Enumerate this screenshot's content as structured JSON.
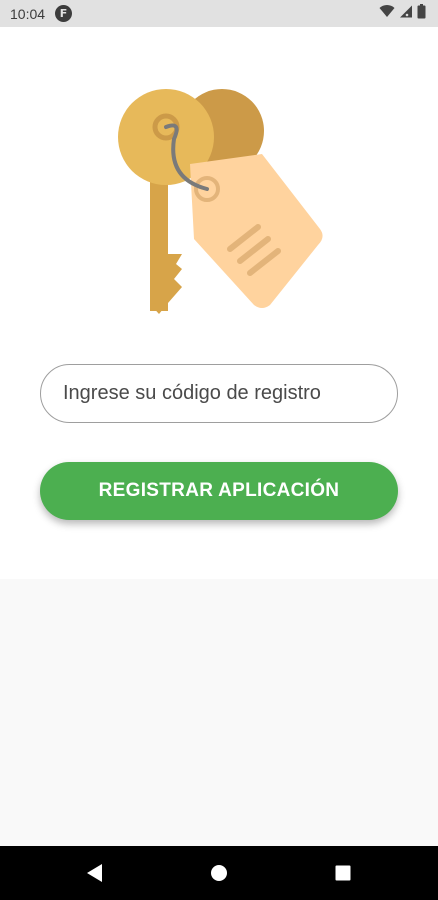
{
  "status_bar": {
    "time": "10:04",
    "notification_icon": "flipboard-icon",
    "notification_letter": "F",
    "icons": [
      "wifi-icon",
      "signal-icon",
      "battery-icon"
    ]
  },
  "illustration": {
    "icon": "keys-with-tag-icon",
    "colors": {
      "key_front": "#E7B95A",
      "key_back": "#CC9A48",
      "key_shaft": "#D7A449",
      "tag": "#FFD39E",
      "tag_lines": "#E3B47A",
      "cord": "#7A7A7A"
    }
  },
  "form": {
    "code_placeholder": "Ingrese su código de registro",
    "code_value": "",
    "register_label": "REGISTRAR APLICACIÓN"
  },
  "nav_bar": {
    "buttons": [
      "back-icon",
      "home-icon",
      "recents-icon"
    ]
  },
  "colors": {
    "accent": "#4CAF50",
    "status_bar_bg": "#E1E1E1",
    "page_bg": "#FFFFFF",
    "lower_bg": "#F9F9F9",
    "nav_bg": "#000000"
  }
}
